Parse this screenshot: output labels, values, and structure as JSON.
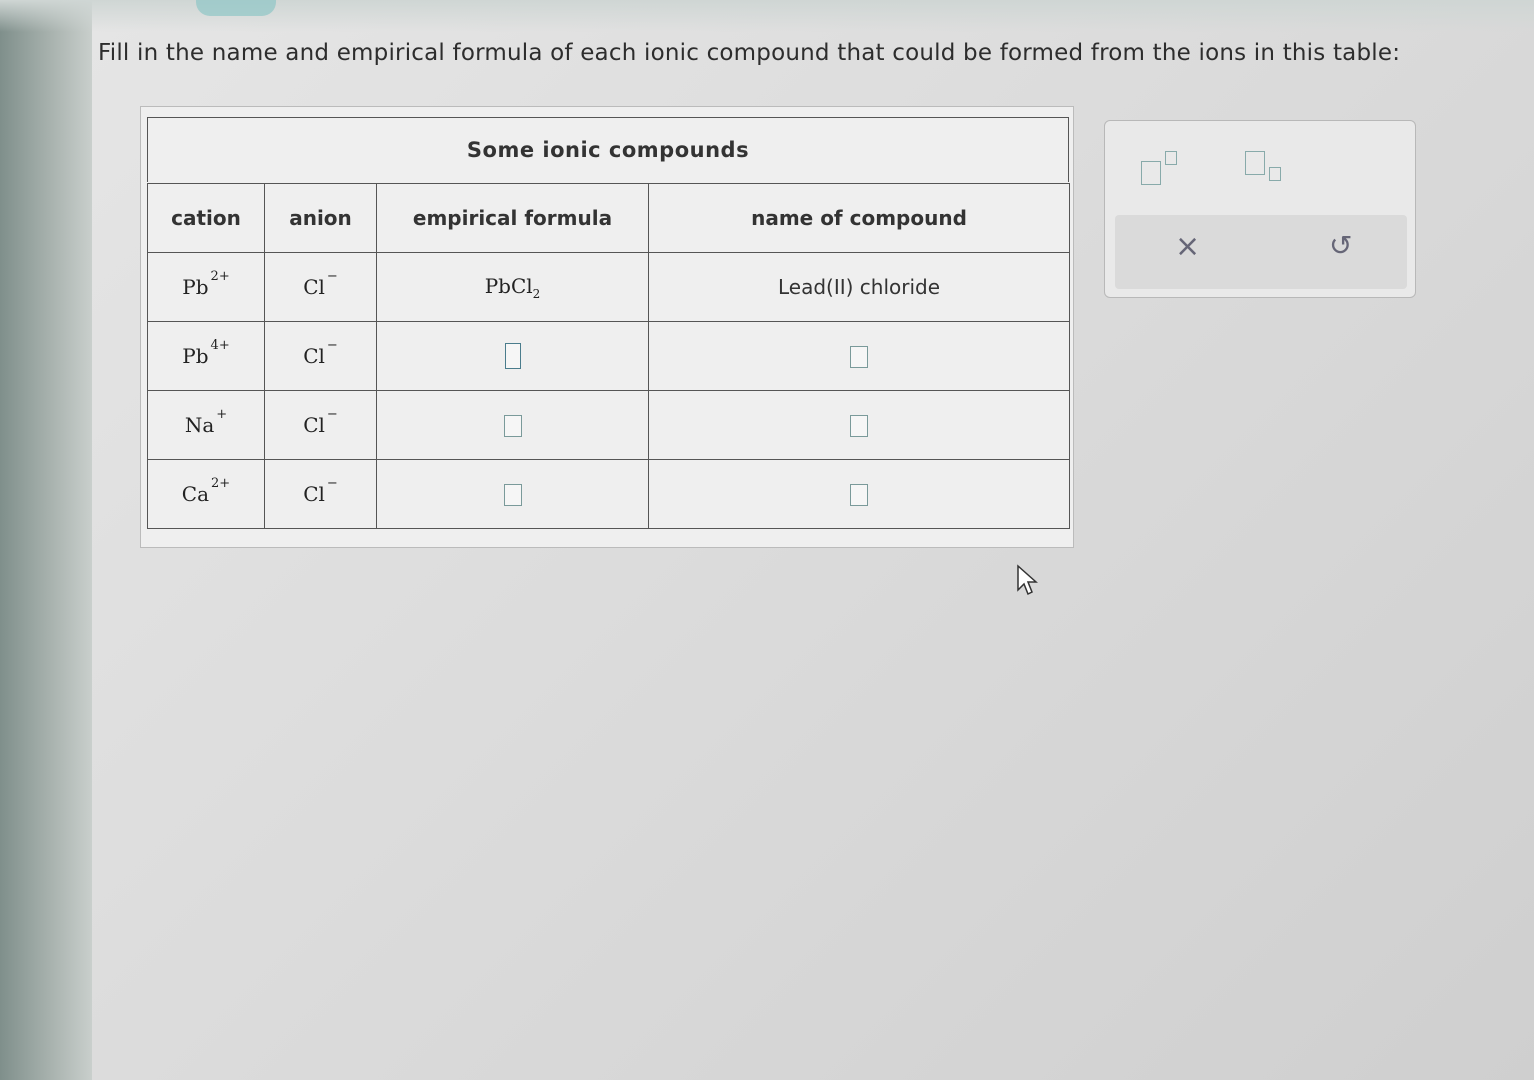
{
  "prompt": "Fill in the name and empirical formula of each ionic compound that could be formed from the ions in this table:",
  "table": {
    "title": "Some ionic compounds",
    "headers": [
      "cation",
      "anion",
      "empirical formula",
      "name of compound"
    ],
    "rows": [
      {
        "cation": "Pb",
        "cation_charge": "2+",
        "anion": "Cl",
        "anion_charge": "−",
        "formula_base": "PbCl",
        "formula_sub": "2",
        "name": "Lead(II) chloride"
      },
      {
        "cation": "Pb",
        "cation_charge": "4+",
        "anion": "Cl",
        "anion_charge": "−",
        "formula_base": "",
        "formula_sub": "",
        "name": ""
      },
      {
        "cation": "Na",
        "cation_charge": "+",
        "anion": "Cl",
        "anion_charge": "−",
        "formula_base": "",
        "formula_sub": "",
        "name": ""
      },
      {
        "cation": "Ca",
        "cation_charge": "2+",
        "anion": "Cl",
        "anion_charge": "−",
        "formula_base": "",
        "formula_sub": "",
        "name": ""
      }
    ]
  },
  "palette": {
    "superscript_icon": "superscript-box-icon",
    "subscript_icon": "subscript-box-icon",
    "clear_symbol": "×",
    "undo_symbol": "↺"
  }
}
